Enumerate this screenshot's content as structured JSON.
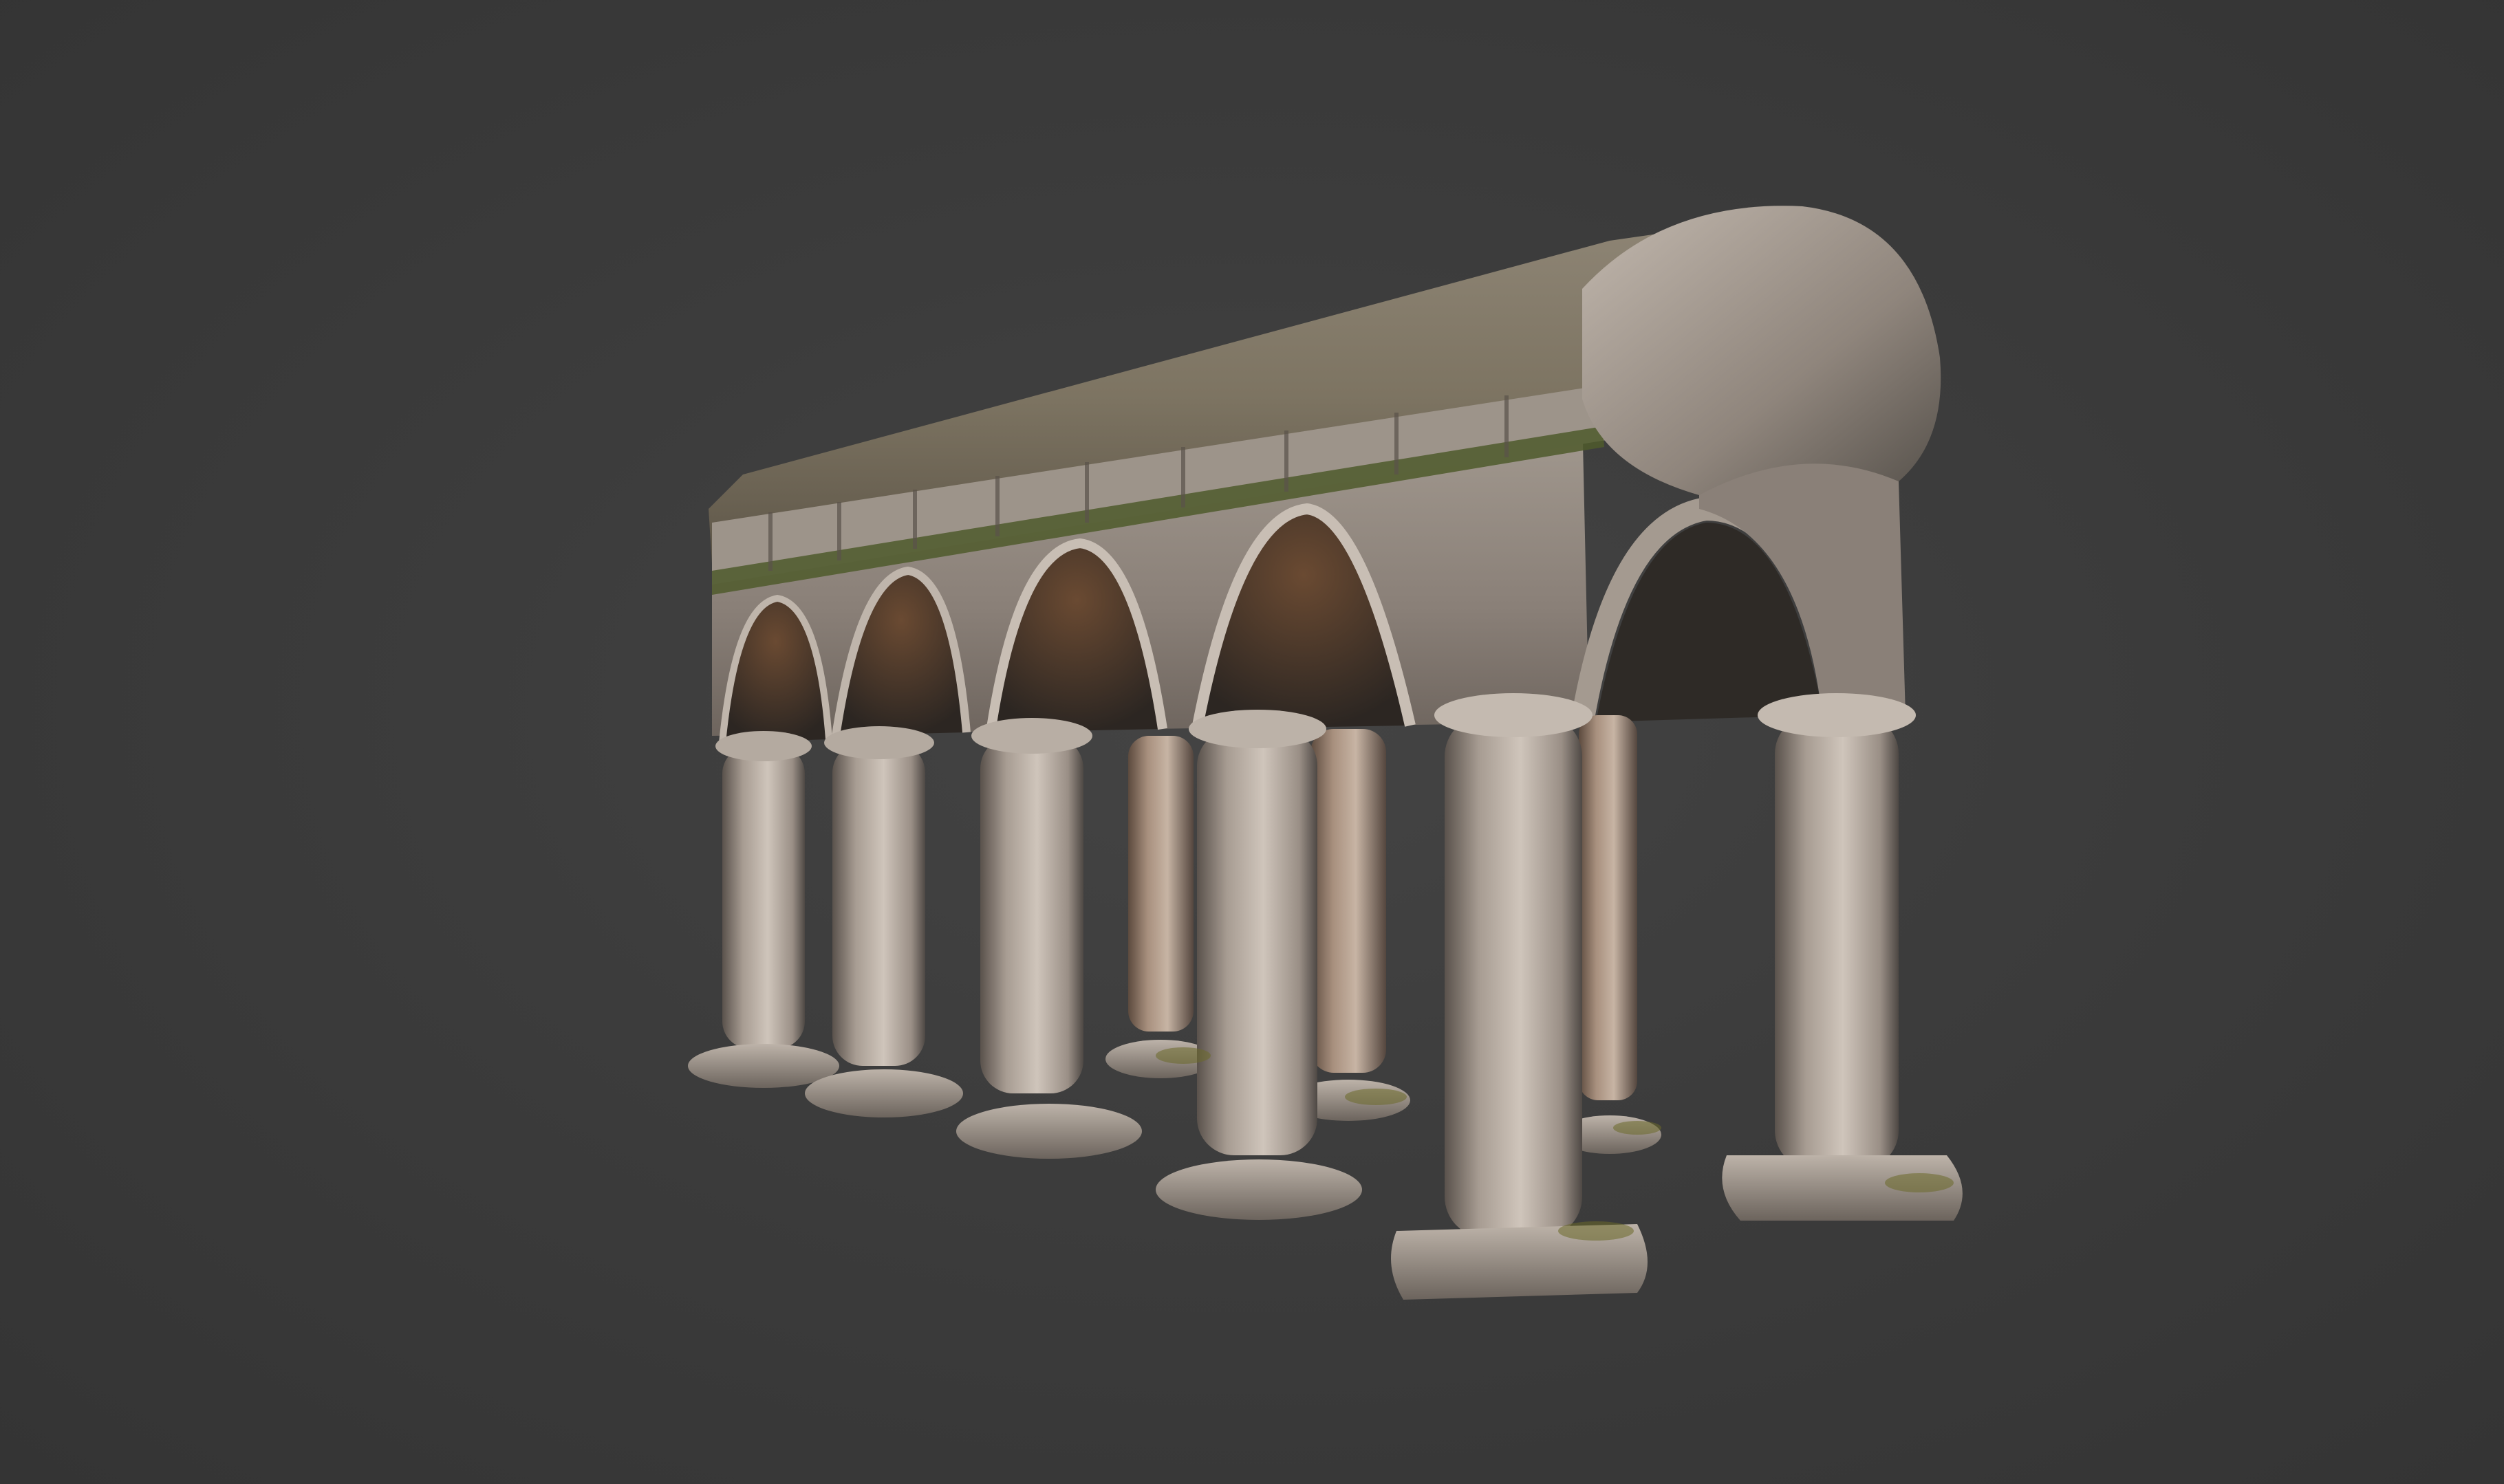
{
  "scene": {
    "subject": "colonnade-model",
    "colors": {
      "background": "#3a3a3a",
      "stone_light": "#c9beb4",
      "stone_mid": "#9e938a",
      "stone_dark": "#4a4440",
      "moss": "#6b6a2a",
      "rust": "#8a5a3a"
    }
  }
}
